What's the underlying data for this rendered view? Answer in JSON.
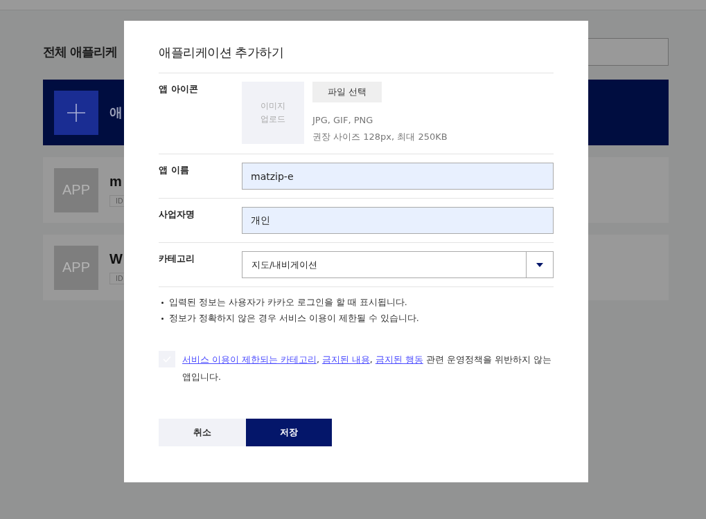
{
  "background": {
    "heading": "전체 애플리케",
    "add_card": {
      "label": "애"
    },
    "apps": [
      {
        "name": "m",
        "badge": "ID",
        "thumb": "APP"
      },
      {
        "name": "W",
        "badge": "ID",
        "thumb": "APP"
      }
    ]
  },
  "dialog": {
    "title": "애플리케이션 추가하기",
    "icon_row": {
      "label": "앱 아이콘",
      "upload_text": "이미지\n업로드",
      "file_button": "파일 선택",
      "hints": [
        "JPG, GIF, PNG",
        "권장 사이즈 128px, 최대 250KB"
      ]
    },
    "fields": [
      {
        "kind": "text",
        "label": "앱 이름",
        "value": "matzip-e"
      },
      {
        "kind": "text",
        "label": "사업자명",
        "value": "개인"
      },
      {
        "kind": "select",
        "label": "카테고리",
        "value": "지도/내비게이션"
      }
    ],
    "notes": [
      "입력된 정보는 사용자가 카카오 로그인을 할 때 표시됩니다.",
      "정보가 정확하지 않은 경우 서비스 이용이 제한될 수 있습니다."
    ],
    "agreement": {
      "checked": false,
      "parts": [
        {
          "kind": "link",
          "text": "서비스 이용이 제한되는 카테고리"
        },
        {
          "kind": "text",
          "text": ", "
        },
        {
          "kind": "link",
          "text": "금지된 내용"
        },
        {
          "kind": "text",
          "text": ", "
        },
        {
          "kind": "link",
          "text": "금지된 행동"
        },
        {
          "kind": "text",
          "text": " 관련 운영정책을 위반하지 않는 앱입니다."
        }
      ]
    },
    "buttons": [
      {
        "kind": "secondary",
        "label": "취소"
      },
      {
        "kind": "primary",
        "label": "저장"
      }
    ]
  }
}
